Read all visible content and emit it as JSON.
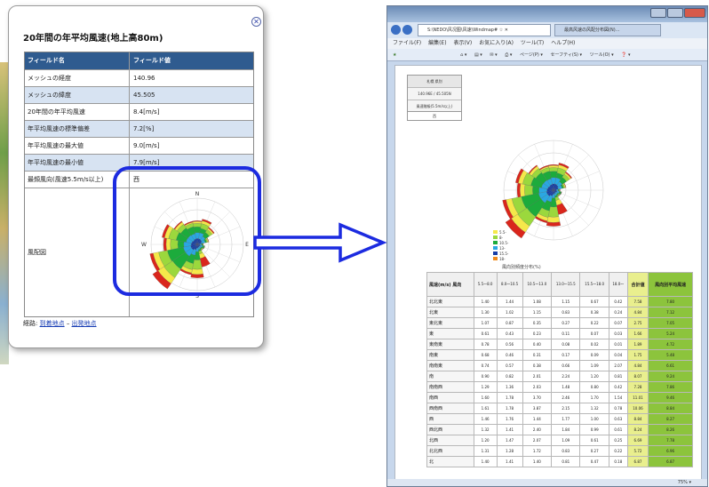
{
  "popup": {
    "title": "20年間の年平均風速(地上高80m)",
    "close_label": "✕",
    "header": {
      "field": "フィールド名",
      "value": "フィールド値"
    },
    "rows": [
      {
        "field": "メッシュの経度",
        "value": "140.96"
      },
      {
        "field": "メッシュの緯度",
        "value": "45.505"
      },
      {
        "field": "20年間の年平均風速",
        "value": "8.4[m/s]"
      },
      {
        "field": "年平均風速の標準偏差",
        "value": "7.2[%]"
      },
      {
        "field": "年平均風速の最大値",
        "value": "9.0[m/s]"
      },
      {
        "field": "年平均風速の最小値",
        "value": "7.9[m/s]"
      },
      {
        "field": "最頻風向(風速5.5m/s以上)",
        "value": "西"
      }
    ],
    "rose_label": "風配図",
    "rose_compass": {
      "north": "N",
      "south": "S",
      "east": "E",
      "west": "W"
    },
    "footer": {
      "prefix": "経路: ",
      "link1": "到着地点",
      "sep": " – ",
      "link2": "出発地点"
    }
  },
  "browser": {
    "tab_active": "S:\\NEDO\\风况图\\风速\\Windmap#  ☆ ✕",
    "tab_other": "最高风速の风配分布図(N)…",
    "menu": [
      "ファイル(F)",
      "編集(E)",
      "表示(V)",
      "お気に入り(A)",
      "ツール(T)",
      "ヘルプ(H)"
    ],
    "commands": [
      "ページ(P) ▾",
      "セーフティ(S) ▾",
      "ツール(O) ▾",
      "❓ ▾"
    ],
    "site_box": [
      "札幌 県別",
      "140.96E / 45.505N",
      "風速階級(5.5m/s以上)",
      "西"
    ],
    "table_title": "風向別頻度分布(%)",
    "table_head": {
      "direction": "風速(m/s)\n風向",
      "bins": [
        "5.5〜8.0",
        "8.0〜10.5",
        "10.5〜13.0",
        "13.0〜15.5",
        "15.5〜18.0",
        "18.0〜"
      ],
      "total": "合計値",
      "mean": "風向別平均風速"
    },
    "table_rows": [
      {
        "dir": "北北東",
        "vals": [
          "1.40",
          "1.44",
          "1.08",
          "1.15",
          "0.67",
          "0.42"
        ],
        "total": "7.58",
        "mean": "7.80"
      },
      {
        "dir": "北東",
        "vals": [
          "1.30",
          "1.02",
          "1.15",
          "0.83",
          "0.38",
          "0.24"
        ],
        "total": "4.84",
        "mean": "7.12"
      },
      {
        "dir": "東北東",
        "vals": [
          "1.07",
          "0.87",
          "0.35",
          "0.27",
          "0.22",
          "0.07"
        ],
        "total": "2.75",
        "mean": "7.05"
      },
      {
        "dir": "東",
        "vals": [
          "0.61",
          "0.43",
          "0.23",
          "0.11",
          "0.07",
          "0.03"
        ],
        "total": "1.66",
        "mean": "5.24"
      },
      {
        "dir": "東南東",
        "vals": [
          "0.78",
          "0.56",
          "0.40",
          "0.08",
          "0.02",
          "0.01"
        ],
        "total": "1.89",
        "mean": "4.72"
      },
      {
        "dir": "南東",
        "vals": [
          "0.68",
          "0.46",
          "0.31",
          "0.17",
          "0.09",
          "0.04"
        ],
        "total": "1.75",
        "mean": "5.48"
      },
      {
        "dir": "南南東",
        "vals": [
          "0.74",
          "0.57",
          "0.38",
          "0.66",
          "1.09",
          "2.07"
        ],
        "total": "4.84",
        "mean": "6.61"
      },
      {
        "dir": "南",
        "vals": [
          "0.90",
          "0.82",
          "2.01",
          "2.24",
          "1.20",
          "0.81"
        ],
        "total": "8.07",
        "mean": "9.24"
      },
      {
        "dir": "南南西",
        "vals": [
          "1.29",
          "1.36",
          "2.03",
          "1.48",
          "0.80",
          "0.42"
        ],
        "total": "7.28",
        "mean": "7.86"
      },
      {
        "dir": "南西",
        "vals": [
          "1.60",
          "1.78",
          "3.70",
          "2.46",
          "1.70",
          "1.54"
        ],
        "total": "11.01",
        "mean": "9.46"
      },
      {
        "dir": "西南西",
        "vals": [
          "1.61",
          "1.78",
          "3.87",
          "2.15",
          "1.32",
          "0.78"
        ],
        "total": "10.06",
        "mean": "8.84"
      },
      {
        "dir": "西",
        "vals": [
          "1.46",
          "1.76",
          "1.44",
          "1.77",
          "1.00",
          "0.63"
        ],
        "total": "8.84",
        "mean": "8.27"
      },
      {
        "dir": "西北西",
        "vals": [
          "1.32",
          "1.41",
          "2.40",
          "1.84",
          "0.99",
          "0.61"
        ],
        "total": "8.24",
        "mean": "8.26"
      },
      {
        "dir": "北西",
        "vals": [
          "1.20",
          "1.47",
          "2.07",
          "1.09",
          "0.61",
          "0.25"
        ],
        "total": "6.69",
        "mean": "7.78"
      },
      {
        "dir": "北北西",
        "vals": [
          "1.31",
          "1.28",
          "1.72",
          "0.83",
          "0.27",
          "0.22"
        ],
        "total": "5.72",
        "mean": "6.96"
      },
      {
        "dir": "北",
        "vals": [
          "1.40",
          "1.41",
          "1.40",
          "0.81",
          "0.47",
          "0.18"
        ],
        "total": "6.87",
        "mean": "6.87"
      }
    ],
    "status_zoom": "75%  ▾"
  },
  "legend": [
    {
      "label": "5.5-",
      "color": "#f5e84a"
    },
    {
      "label": "8-",
      "color": "#9bd83d"
    },
    {
      "label": "10.5-",
      "color": "#1cab3c"
    },
    {
      "label": "13-",
      "color": "#2aa7e2"
    },
    {
      "label": "15.5-",
      "color": "#173ea8"
    },
    {
      "label": "18-",
      "color": "#f08a1c"
    }
  ],
  "colors": {
    "accent_blue": "#1c2be0",
    "header_blue": "#2f5b8f",
    "total_yellow": "#e9ef8e",
    "mean_green": "#8cc43c"
  }
}
